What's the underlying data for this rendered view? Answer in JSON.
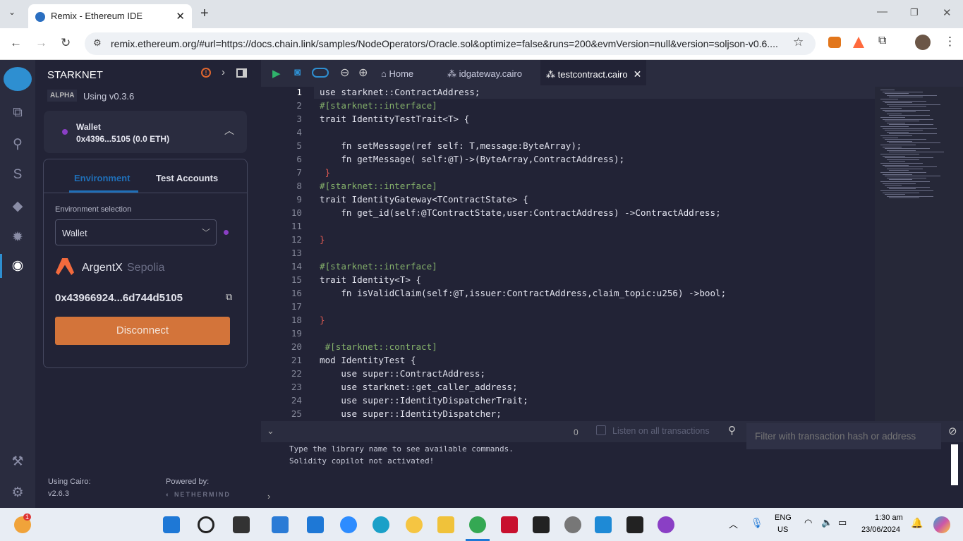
{
  "browser": {
    "tab_title": "Remix - Ethereum IDE",
    "url": "remix.ethereum.org/#url=https://docs.chain.link/samples/NodeOperators/Oracle.sol&optimize=false&runs=200&evmVersion=null&version=soljson-v0.6...."
  },
  "plugin": {
    "title": "STARKNET",
    "badge": "ALPHA",
    "version": "Using v0.3.6",
    "wallet_label": "Wallet",
    "wallet_address": "0x4396...5105 (0.0 ETH)",
    "tabs": [
      "Environment",
      "Test Accounts"
    ],
    "env_label": "Environment selection",
    "env_value": "Wallet",
    "wallet_name": "ArgentX",
    "network": "Sepolia",
    "full_address": "0x43966924...6d744d5105",
    "disconnect": "Disconnect",
    "using_cairo": "Using Cairo:",
    "cairo_version": "v2.6.3",
    "powered_by": "Powered by:",
    "powered_logo": "NETHERMIND",
    "accent": "#1f6fb8",
    "button_color": "#d3743a"
  },
  "editor": {
    "tabs": [
      "Home",
      "idgateway.cairo",
      "testcontract.cairo"
    ],
    "lines": [
      "use starknet::ContractAddress;",
      "#[starknet::interface]",
      "trait IdentityTestTrait<T> {",
      "",
      "    fn setMessage(ref self: T,message:ByteArray);",
      "    fn getMessage( self:@T)->(ByteArray,ContractAddress);",
      " }",
      "#[starknet::interface]",
      "trait IdentityGateway<TContractState> {",
      "    fn get_id(self:@TContractState,user:ContractAddress) ->ContractAddress;",
      "",
      "}",
      "",
      "#[starknet::interface]",
      "trait Identity<T> {",
      "    fn isValidClaim(self:@T,issuer:ContractAddress,claim_topic:u256) ->bool;",
      "",
      "}",
      "",
      " #[starknet::contract]",
      "mod IdentityTest {",
      "    use super::ContractAddress;",
      "    use starknet::get_caller_address;",
      "    use super::IdentityDispatcherTrait;",
      "    use super::IdentityDispatcher;"
    ]
  },
  "terminal": {
    "count": "0",
    "listen": "Listen on all transactions",
    "filter_placeholder": "Filter with transaction hash or address",
    "lines": [
      "Type the library name to see available commands.",
      "Solidity copilot not activated!"
    ]
  },
  "taskbar": {
    "lang": "ENG",
    "region": "US",
    "time": "1:30 am",
    "date": "23/06/2024",
    "badge": "1"
  }
}
